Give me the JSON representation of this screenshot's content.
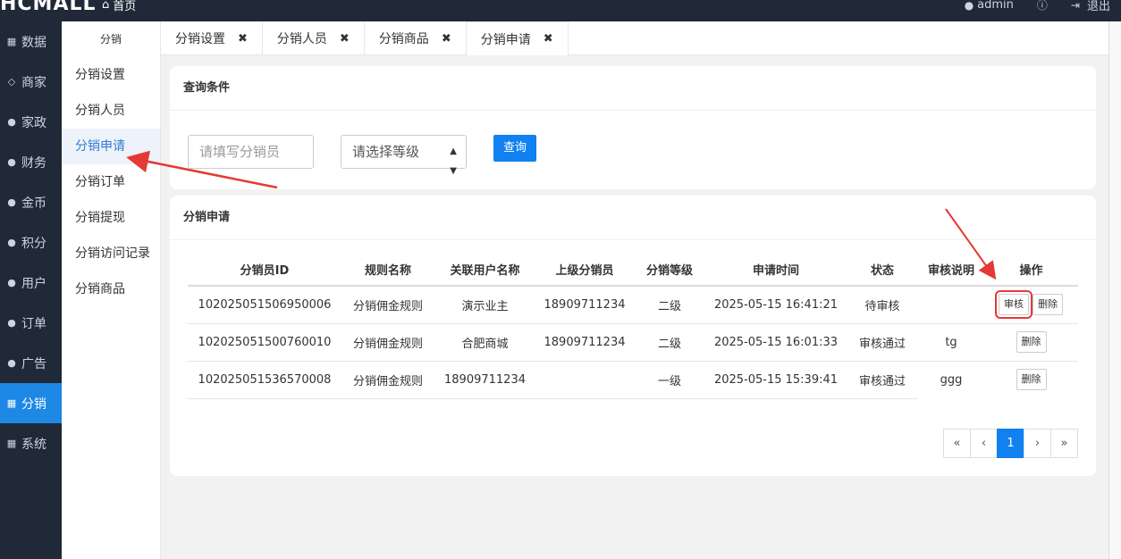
{
  "topbar": {
    "brand": "HCMALL",
    "home": "首页",
    "user": "admin",
    "logout": "退出"
  },
  "leftnav": [
    {
      "label": "数据",
      "icon": "grid-icon"
    },
    {
      "label": "商家",
      "icon": "diamond-icon"
    },
    {
      "label": "家政",
      "icon": "globe-icon"
    },
    {
      "label": "财务",
      "icon": "globe-icon"
    },
    {
      "label": "金币",
      "icon": "globe-icon"
    },
    {
      "label": "积分",
      "icon": "globe-icon"
    },
    {
      "label": "用户",
      "icon": "globe-icon"
    },
    {
      "label": "订单",
      "icon": "globe-icon"
    },
    {
      "label": "广告",
      "icon": "globe-icon"
    },
    {
      "label": "分销",
      "icon": "grid-icon",
      "active": true
    },
    {
      "label": "系统",
      "icon": "grid-icon"
    }
  ],
  "subnav": {
    "title": "分销",
    "items": [
      "分销设置",
      "分销人员",
      "分销申请",
      "分销订单",
      "分销提现",
      "分销访问记录",
      "分销商品"
    ],
    "active": "分销申请"
  },
  "tabs": [
    "分销设置",
    "分销人员",
    "分销商品",
    "分销申请"
  ],
  "active_tab": "分销申请",
  "query": {
    "title": "查询条件",
    "input_placeholder": "请填写分销员",
    "select_value": "请选择等级",
    "button": "查询"
  },
  "list": {
    "title": "分销申请",
    "columns": [
      "分销员ID",
      "规则名称",
      "关联用户名称",
      "上级分销员",
      "分销等级",
      "申请时间",
      "状态",
      "审核说明",
      "操作"
    ],
    "rows": [
      {
        "id": "102025051506950006",
        "rule": "分销佣金规则",
        "user": "演示业主",
        "parent": "18909711234",
        "level": "二级",
        "time": "2025-05-15 16:41:21",
        "status": "待审核",
        "note": "",
        "actions": [
          "审核",
          "删除"
        ]
      },
      {
        "id": "102025051500760010",
        "rule": "分销佣金规则",
        "user": "合肥商城",
        "parent": "18909711234",
        "level": "二级",
        "time": "2025-05-15 16:01:33",
        "status": "审核通过",
        "note": "tg",
        "actions": [
          "删除"
        ]
      },
      {
        "id": "102025051536570008",
        "rule": "分销佣金规则",
        "user": "18909711234",
        "parent": "",
        "level": "一级",
        "time": "2025-05-15 15:39:41",
        "status": "审核通过",
        "note": "ggg",
        "actions": [
          "删除"
        ]
      }
    ]
  },
  "pager": {
    "items": [
      "«",
      "‹",
      "1",
      "›",
      "»"
    ],
    "current": "1"
  },
  "annotation_color": "#e53935"
}
